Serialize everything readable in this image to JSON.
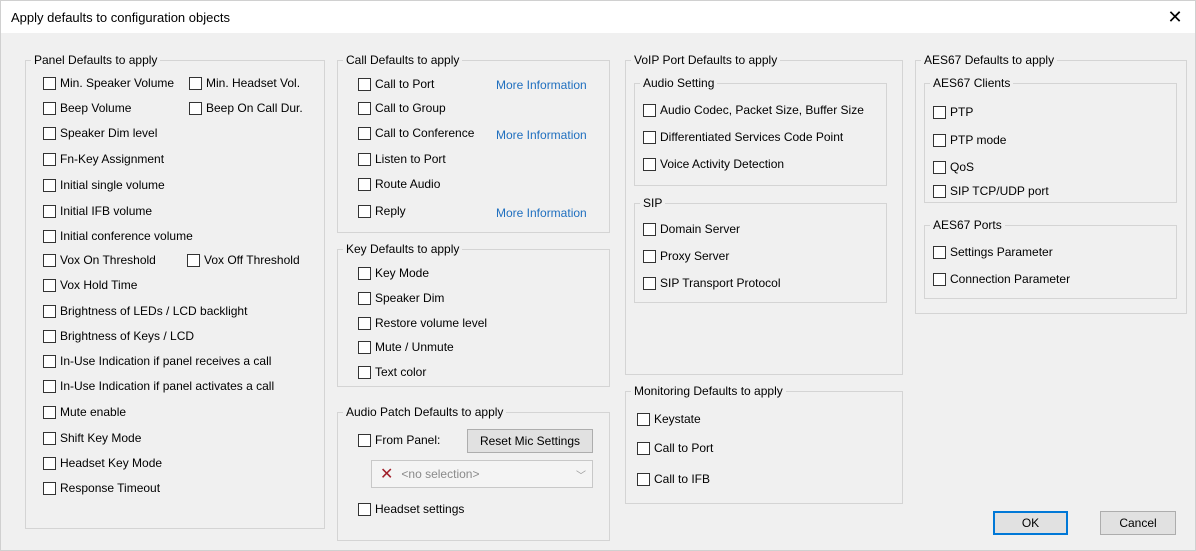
{
  "window": {
    "title": "Apply defaults to configuration objects",
    "close_glyph": "✕"
  },
  "panel": {
    "title": "Panel Defaults to apply",
    "items": [
      "Min. Speaker Volume",
      "Min. Headset Vol.",
      "Beep Volume",
      "Beep On Call Dur.",
      "Speaker Dim level",
      "Fn-Key Assignment",
      "Initial single volume",
      "Initial IFB volume",
      "Initial conference volume",
      "Vox On Threshold",
      "Vox Off Threshold",
      "Vox Hold Time",
      "Brightness of LEDs / LCD backlight",
      "Brightness of Keys / LCD",
      "In-Use Indication if panel receives a call",
      "In-Use Indication if panel activates a call",
      "Mute enable",
      "Shift Key Mode",
      "Headset Key Mode",
      "Response Timeout"
    ]
  },
  "call": {
    "title": "Call Defaults to apply",
    "items": [
      "Call to Port",
      "Call to Group",
      "Call to Conference",
      "Listen to Port",
      "Route Audio",
      "Reply"
    ],
    "more_info": "More Information"
  },
  "key": {
    "title": "Key Defaults to apply",
    "items": [
      "Key Mode",
      "Speaker Dim",
      "Restore volume level",
      "Mute / Unmute",
      "Text color"
    ]
  },
  "audio_patch": {
    "title": "Audio Patch Defaults to apply",
    "from_panel": "From Panel:",
    "reset_button": "Reset Mic Settings",
    "combo_placeholder": "<no selection>",
    "headset": "Headset settings"
  },
  "voip": {
    "title": "VoIP Port Defaults to apply",
    "audio_title": "Audio Setting",
    "audio_items": [
      "Audio Codec, Packet Size, Buffer Size",
      "Differentiated Services Code Point",
      "Voice Activity Detection"
    ],
    "sip_title": "SIP",
    "sip_items": [
      "Domain Server",
      "Proxy Server",
      "SIP Transport Protocol"
    ]
  },
  "monitoring": {
    "title": "Monitoring Defaults to apply",
    "items": [
      "Keystate",
      "Call to Port",
      "Call to IFB"
    ]
  },
  "aes67": {
    "title": "AES67 Defaults to apply",
    "clients_title": "AES67 Clients",
    "clients_items": [
      "PTP",
      "PTP mode",
      "QoS",
      "SIP TCP/UDP port"
    ],
    "ports_title": "AES67 Ports",
    "ports_items": [
      "Settings Parameter",
      "Connection Parameter"
    ]
  },
  "buttons": {
    "ok": "OK",
    "cancel": "Cancel"
  }
}
